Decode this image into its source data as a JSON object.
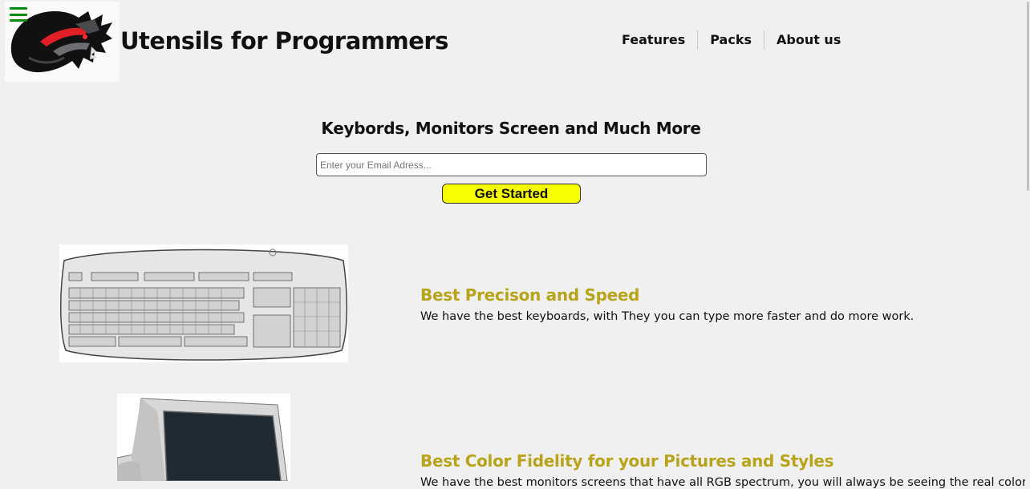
{
  "header": {
    "logo_icon": "wolf-logo-icon",
    "menu_icon": "hamburger-menu-icon",
    "title": "Utensils for Programmers",
    "nav": [
      {
        "label": "Features"
      },
      {
        "label": "Packs"
      },
      {
        "label": "About us"
      }
    ]
  },
  "hero": {
    "title": "Keybords, Monitors Screen and Much More",
    "email_placeholder": "Enter your Email Adress...",
    "email_value": "",
    "cta_label": "Get Started"
  },
  "features": [
    {
      "image_icon": "keyboard-image",
      "title": "Best Precison and Speed",
      "text": "We have the best keyboards, with They you can type more faster and do more work."
    },
    {
      "image_icon": "monitor-image",
      "title": "Best Color Fidelity for your Pictures and Styles",
      "text": "We have the best monitors screens that have all RGB spectrum, you will always be seeing the real color that"
    }
  ],
  "colors": {
    "background": "#f0f0f0",
    "accent_title": "#b8a41a",
    "cta_background": "#f7ff00",
    "menu_icon": "#0a8a0a",
    "logo_red": "#d9222a"
  }
}
